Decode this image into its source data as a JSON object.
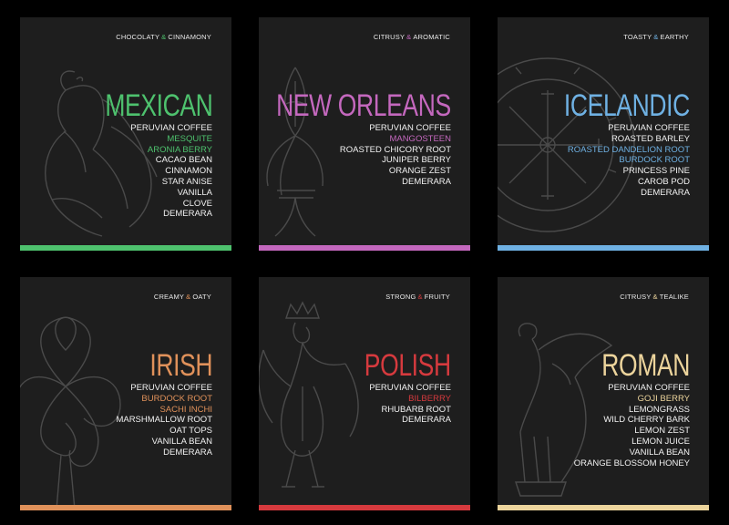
{
  "cards": [
    {
      "tagline": [
        "CHOCOLATY",
        "&",
        "CINNAMONY"
      ],
      "title": "MEXICAN",
      "accent": "#4ec26e",
      "ingredients": [
        "PERUVIAN COFFEE",
        "MESQUITE",
        "ARONIA BERRY",
        "CACAO BEAN",
        "CINNAMON",
        "STAR ANISE",
        "VANILLA",
        "CLOVE",
        "DEMERARA"
      ],
      "highlighted": [
        1,
        2
      ],
      "illustration": "eagle-icon"
    },
    {
      "tagline": [
        "CITRUSY",
        "&",
        "AROMATIC"
      ],
      "title": "NEW ORLEANS",
      "accent": "#c468be",
      "ingredients": [
        "PERUVIAN COFFEE",
        "MANGOSTEEN",
        "ROASTED CHICORY ROOT",
        "JUNIPER BERRY",
        "ORANGE ZEST",
        "DEMERARA"
      ],
      "highlighted": [
        1
      ],
      "illustration": "fleur-de-lis-icon"
    },
    {
      "tagline": [
        "TOASTY",
        "&",
        "EARTHY"
      ],
      "title": "ICELANDIC",
      "accent": "#6fb1e3",
      "ingredients": [
        "PERUVIAN COFFEE",
        "ROASTED BARLEY",
        "ROASTED DANDELION ROOT",
        "BURDOCK ROOT",
        "PRINCESS PINE",
        "CAROB POD",
        "DEMERARA"
      ],
      "highlighted": [
        2,
        3
      ],
      "illustration": "vegvisir-icon"
    },
    {
      "tagline": [
        "CREAMY",
        "&",
        "OATY"
      ],
      "title": "IRISH",
      "accent": "#e0915a",
      "ingredients": [
        "PERUVIAN COFFEE",
        "BURDOCK ROOT",
        "SACHI INCHI",
        "MARSHMALLOW ROOT",
        "OAT TOPS",
        "VANILLA BEAN",
        "DEMERARA"
      ],
      "highlighted": [
        1,
        2
      ],
      "illustration": "celtic-knot-icon"
    },
    {
      "tagline": [
        "STRONG",
        "&",
        "FRUITY"
      ],
      "title": "POLISH",
      "accent": "#d63a3e",
      "ingredients": [
        "PERUVIAN COFFEE",
        "BILBERRY",
        "RHUBARB ROOT",
        "DEMERARA"
      ],
      "highlighted": [
        1
      ],
      "illustration": "crowned-eagle-icon"
    },
    {
      "tagline": [
        "CITRUSY",
        "&",
        "TEALIKE"
      ],
      "title": "ROMAN",
      "accent": "#ecd49c",
      "ingredients": [
        "PERUVIAN COFFEE",
        "GOJI BERRY",
        "LEMONGRASS",
        "WILD CHERRY BARK",
        "LEMON ZEST",
        "LEMON JUICE",
        "VANILLA BEAN",
        "ORANGE BLOSSOM HONEY"
      ],
      "highlighted": [
        1
      ],
      "illustration": "roman-eagle-icon"
    }
  ]
}
